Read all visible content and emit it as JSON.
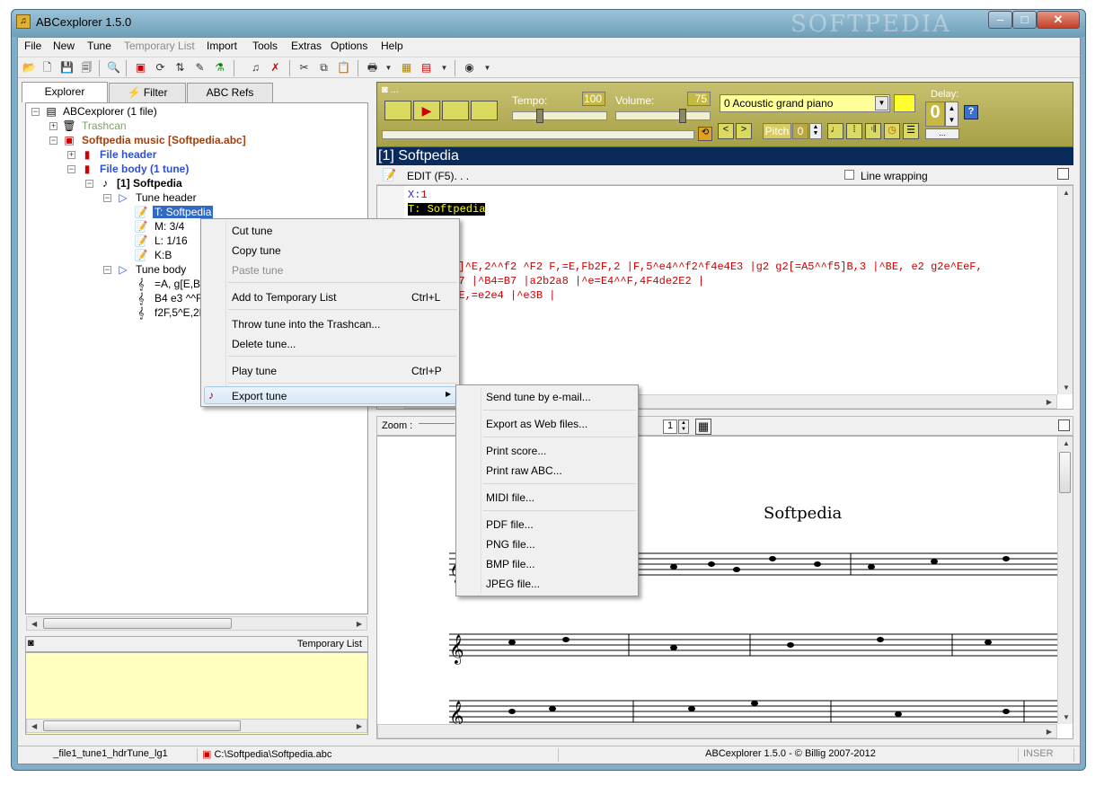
{
  "window": {
    "title": "ABCexplorer 1.5.0",
    "watermark": "SOFTPEDIA"
  },
  "menu": [
    "File",
    "New",
    "Tune",
    "Temporary List",
    "Import",
    "Tools",
    "Extras",
    "Options",
    "Help"
  ],
  "tabs": [
    "Explorer",
    "Filter",
    "ABC Refs"
  ],
  "tree": {
    "root": "ABCexplorer (1 file)",
    "trashcan": "Trashcan",
    "file": "Softpedia music [Softpedia.abc]",
    "file_header": "File header",
    "file_body": "File body (1 tune)",
    "tune": "[1]  Softpedia",
    "tune_header": "Tune header",
    "header_items": [
      "T: Softpedia",
      "M: 3/4",
      "L: 1/16",
      "K:B"
    ],
    "tune_body": "Tune body",
    "body_items": [
      "=A, g[E,B]^",
      "B4 e3 ^^F7",
      "f2F,5^E,2E"
    ]
  },
  "temp_list": {
    "title": "Temporary List"
  },
  "player": {
    "tempo_label": "Tempo:",
    "tempo_value": "100",
    "volume_label": "Volume:",
    "volume_value": "75",
    "instrument": "0 Acoustic grand piano",
    "pitch_label": "Pitch",
    "pitch_value": "0",
    "delay_label": "Delay:",
    "delay_value": "0",
    "delay_more": "...",
    "help_glyph": "?"
  },
  "tune_title": "[1]  Softpedia",
  "editor": {
    "edit_label": "EDIT (F5). . .",
    "line_wrapping": "Line wrapping",
    "line1_key": "X:",
    "line1_val": "1",
    "line2": "T: Softpedia",
    "line3": ",B]^E,2^^f2 ^F2 F,=E,Fb2F,2 |F,5^e4^^f2^f4e4E3 |g2 g2[=A5^^f5]B,3 |^BE, e2 g2e^EeF,",
    "line4": "^F7 |^B4=B7 |a2b2a8 |^e=E4^^F,4F4de2E2 |",
    "line5": ",2E,=e2e4 |^e3B |"
  },
  "score": {
    "zoom_label": "Zoom :",
    "page_value": "1",
    "title": "Softpedia"
  },
  "context_menu": {
    "items": [
      "Cut tune",
      "Copy tune",
      "Paste tune",
      "Add to Temporary List",
      "Throw tune into the Trashcan...",
      "Delete tune...",
      "Play tune",
      "Export tune"
    ],
    "shortcut_add": "Ctrl+L",
    "shortcut_play": "Ctrl+P"
  },
  "submenu": {
    "items": [
      "Send tune by e-mail...",
      "Export as Web files...",
      "Print score...",
      "Print raw ABC...",
      "MIDI file...",
      "PDF file...",
      "PNG file...",
      "BMP file...",
      "JPEG file..."
    ]
  },
  "status": {
    "cell1": "_file1_tune1_hdrTune_lg1",
    "cell2": "C:\\Softpedia\\Softpedia.abc",
    "cell3": "ABCexplorer 1.5.0 - © Billig 2007-2012",
    "cell4": "INSER"
  },
  "colors": {
    "player_bg": "#b4ae58",
    "title_bg": "#0a2a5a",
    "highlight": "#316ac5"
  }
}
